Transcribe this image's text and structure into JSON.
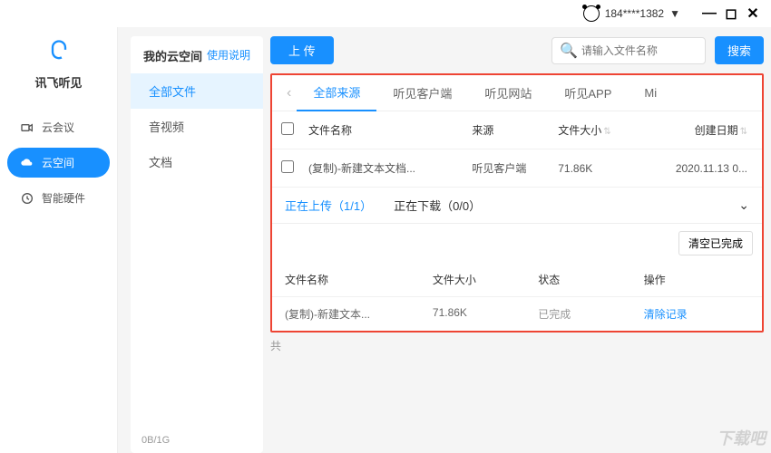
{
  "titlebar": {
    "account": "184****1382",
    "dropdown": "▼"
  },
  "leftnav": {
    "brand": "讯飞听见",
    "items": [
      {
        "label": "云会议"
      },
      {
        "label": "云空间"
      },
      {
        "label": "智能硬件"
      }
    ]
  },
  "midnav": {
    "title": "我的云空间",
    "help": "使用说明",
    "items": [
      {
        "label": "全部文件"
      },
      {
        "label": "音视频"
      },
      {
        "label": "文档"
      }
    ],
    "storage": "0B/1G"
  },
  "toolbar": {
    "upload": "上 传",
    "search_placeholder": "请输入文件名称",
    "search_btn": "搜索"
  },
  "source_tabs": {
    "items": [
      "全部来源",
      "听见客户端",
      "听见网站",
      "听见APP",
      "Mi"
    ]
  },
  "file_table": {
    "headers": {
      "name": "文件名称",
      "source": "来源",
      "size": "文件大小",
      "date": "创建日期"
    },
    "rows": [
      {
        "name": "(复制)-新建文本文档...",
        "source": "听见客户端",
        "size": "71.86K",
        "date": "2020.11.13 0..."
      }
    ]
  },
  "transfer_panel": {
    "upload_tab": "正在上传（1/1）",
    "download_tab": "正在下载（0/0）",
    "clear_done": "清空已完成",
    "headers": {
      "name": "文件名称",
      "size": "文件大小",
      "status": "状态",
      "op": "操作"
    },
    "rows": [
      {
        "name": "(复制)-新建文本...",
        "size": "71.86K",
        "status": "已完成",
        "op": "清除记录"
      }
    ]
  },
  "footer_char": "共"
}
